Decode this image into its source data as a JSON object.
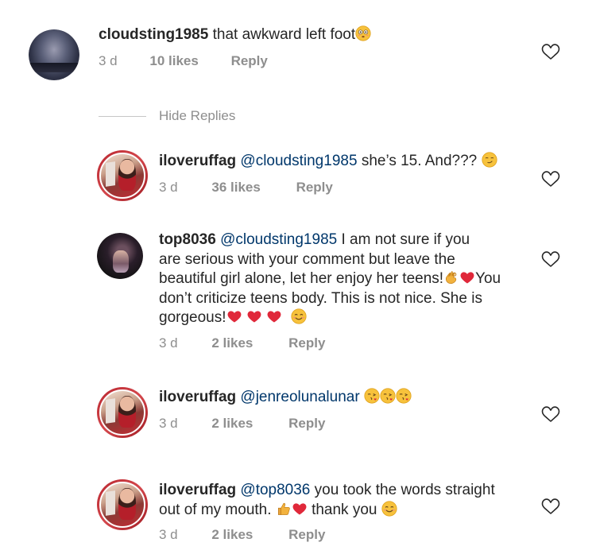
{
  "comments": [
    {
      "username": "cloudsting1985",
      "text": "that awkward left foot",
      "time": "3 d",
      "likes": "10 likes",
      "reply": "Reply"
    },
    {
      "username": "iloveruffag",
      "mention": "@cloudsting1985",
      "text": "she’s 15. And???",
      "time": "3 d",
      "likes": "36 likes",
      "reply": "Reply"
    },
    {
      "username": "top8036",
      "mention": "@cloudsting1985",
      "text1": "I am not sure if you",
      "line2": "are serious with your comment but leave the",
      "line3a": "beautiful girl alone, let her enjoy her teens!",
      "line3b": "You",
      "line4": "don’t criticize teens body. This is not nice. She is",
      "line5": "gorgeous!",
      "time": "3 d",
      "likes": "2 likes",
      "reply": "Reply"
    },
    {
      "username": "iloveruffag",
      "mention": "@jenreolunalunar",
      "time": "3 d",
      "likes": "2 likes",
      "reply": "Reply"
    },
    {
      "username": "iloveruffag",
      "mention": "@top8036",
      "text1": "you took the words straight",
      "line2a": "out of my mouth.",
      "line2b": "thank you",
      "time": "3 d",
      "likes": "2 likes",
      "reply": "Reply"
    }
  ],
  "hide_replies": "Hide Replies",
  "colors": {
    "username": "#262626",
    "mention": "#00376b",
    "meta": "#8e8e8e",
    "heart_outline": "#262626",
    "red_heart": "#e0283a"
  },
  "icons": [
    "heart-outline-icon",
    "flushed-emoji-icon",
    "smirk-emoji-icon",
    "ok-hand-emoji-icon",
    "red-heart-emoji-icon",
    "blush-emoji-icon",
    "kiss-emoji-icon",
    "thumbs-up-emoji-icon"
  ]
}
